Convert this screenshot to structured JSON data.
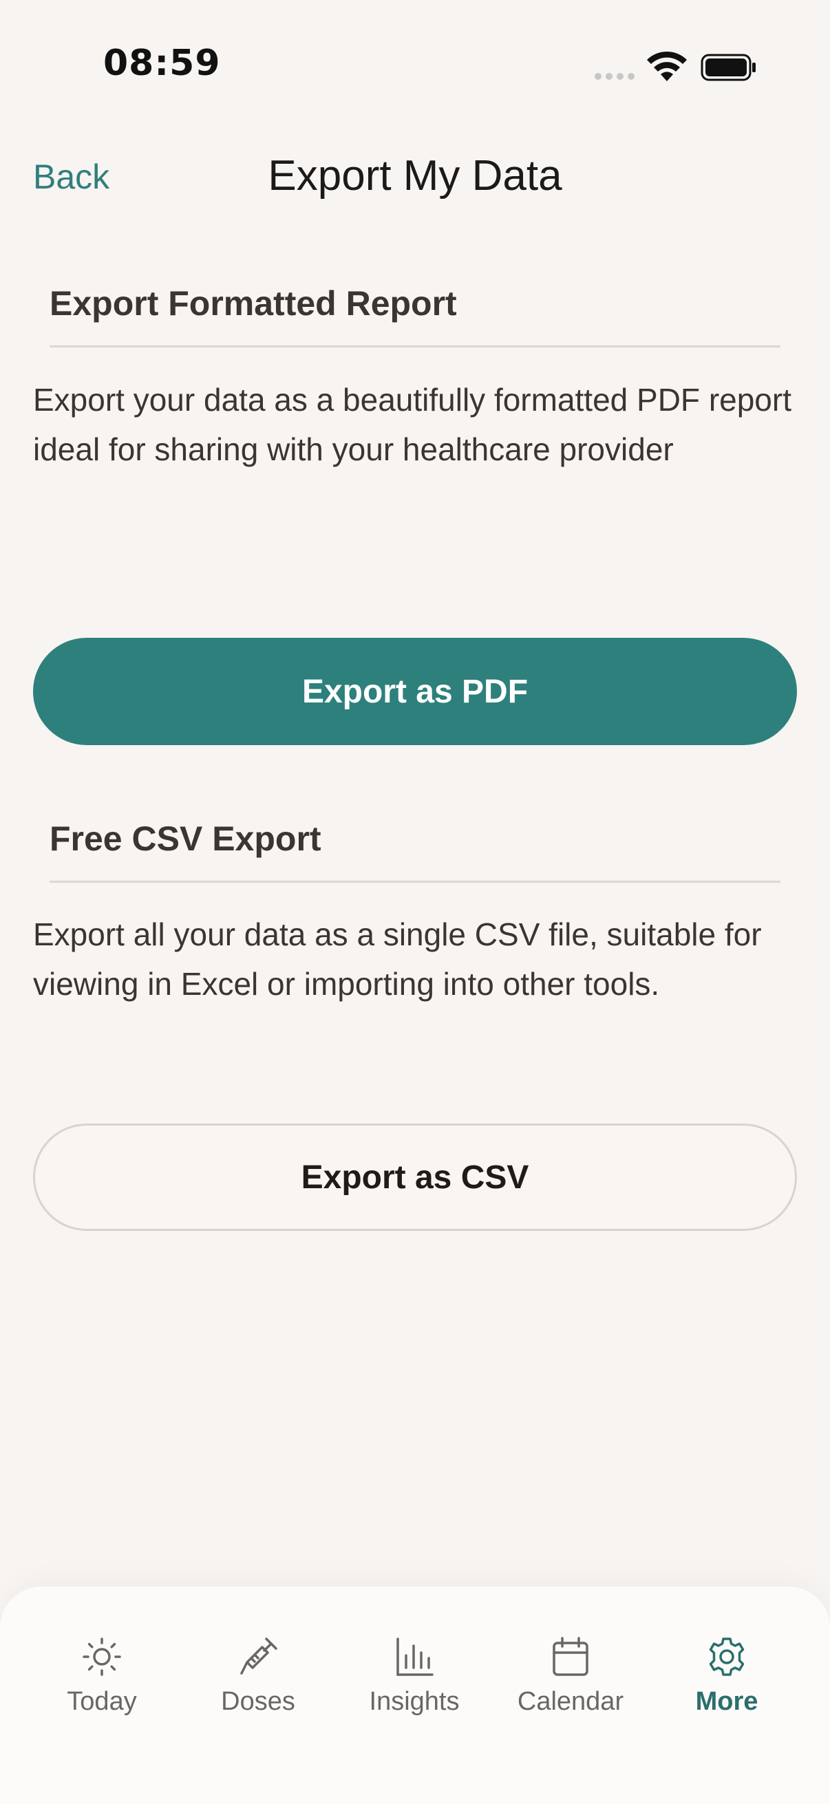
{
  "status_bar": {
    "time": "08:59"
  },
  "nav": {
    "back_label": "Back",
    "title": "Export My Data"
  },
  "sections": {
    "pdf": {
      "heading": "Export Formatted Report",
      "description": "Export your data as a beautifully formatted PDF report ideal for sharing with your healthcare provider",
      "button_label": "Export as PDF"
    },
    "csv": {
      "heading": "Free CSV Export",
      "description": "Export all your data as a single CSV file, suitable for viewing in Excel or importing into other tools.",
      "button_label": "Export as CSV"
    }
  },
  "tab_bar": {
    "items": [
      {
        "label": "Today",
        "icon": "sun-icon"
      },
      {
        "label": "Doses",
        "icon": "syringe-icon"
      },
      {
        "label": "Insights",
        "icon": "bar-chart-icon"
      },
      {
        "label": "Calendar",
        "icon": "calendar-icon"
      },
      {
        "label": "More",
        "icon": "gear-icon",
        "active": true
      }
    ]
  },
  "colors": {
    "accent": "#2e807c",
    "active_tab": "#2b6f6b",
    "background": "#f7f4f1"
  }
}
